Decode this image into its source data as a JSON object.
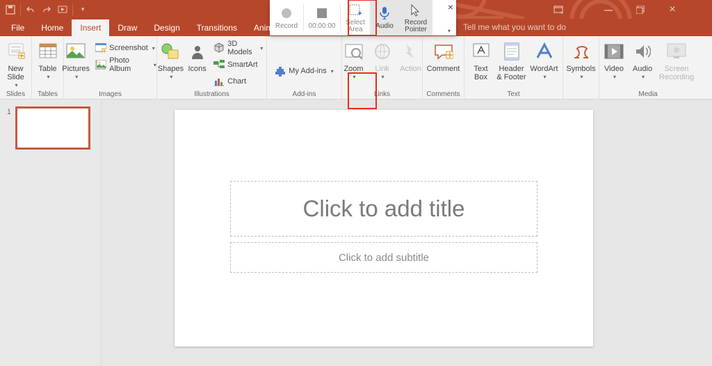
{
  "titlebar": {
    "save": "save",
    "undo": "undo",
    "redo": "redo",
    "startover": "start-from-beginning",
    "ribbonDisp": "ribbon-display",
    "min": "minimize",
    "maxr": "restore",
    "close": "close"
  },
  "tabs": {
    "file": "File",
    "home": "Home",
    "insert": "Insert",
    "draw": "Draw",
    "design": "Design",
    "transitions": "Transitions",
    "animations": "Animations",
    "tellme": "Tell me what you want to do"
  },
  "ribbon": {
    "slides": {
      "newSlide": "New\nSlide",
      "group": "Slides"
    },
    "tables": {
      "table": "Table",
      "group": "Tables"
    },
    "images": {
      "pictures": "Pictures",
      "screenshot": "Screenshot",
      "photoAlbum": "Photo Album",
      "group": "Images"
    },
    "illus": {
      "shapes": "Shapes",
      "icons": "Icons",
      "models": "3D Models",
      "smartart": "SmartArt",
      "chart": "Chart",
      "group": "Illustrations"
    },
    "addins": {
      "myaddins": "My Add-ins",
      "group": "Add-ins"
    },
    "links": {
      "zoom": "Zoom",
      "link": "Link",
      "action": "Action",
      "group": "Links"
    },
    "comments": {
      "comment": "Comment",
      "group": "Comments"
    },
    "text": {
      "textbox": "Text\nBox",
      "header": "Header\n& Footer",
      "wordart": "WordArt",
      "group": "Text"
    },
    "symbols": {
      "symbols": "Symbols",
      "group": ""
    },
    "media": {
      "video": "Video",
      "audio": "Audio",
      "screc": "Screen\nRecording",
      "group": "Media"
    }
  },
  "recpane": {
    "record": "Record",
    "time": "00:00:00",
    "select": "Select\nArea",
    "audio": "Audio",
    "pointer": "Record\nPointer"
  },
  "thumbs": {
    "n1": "1"
  },
  "slide": {
    "title": "Click to add title",
    "sub": "Click to add subtitle"
  }
}
